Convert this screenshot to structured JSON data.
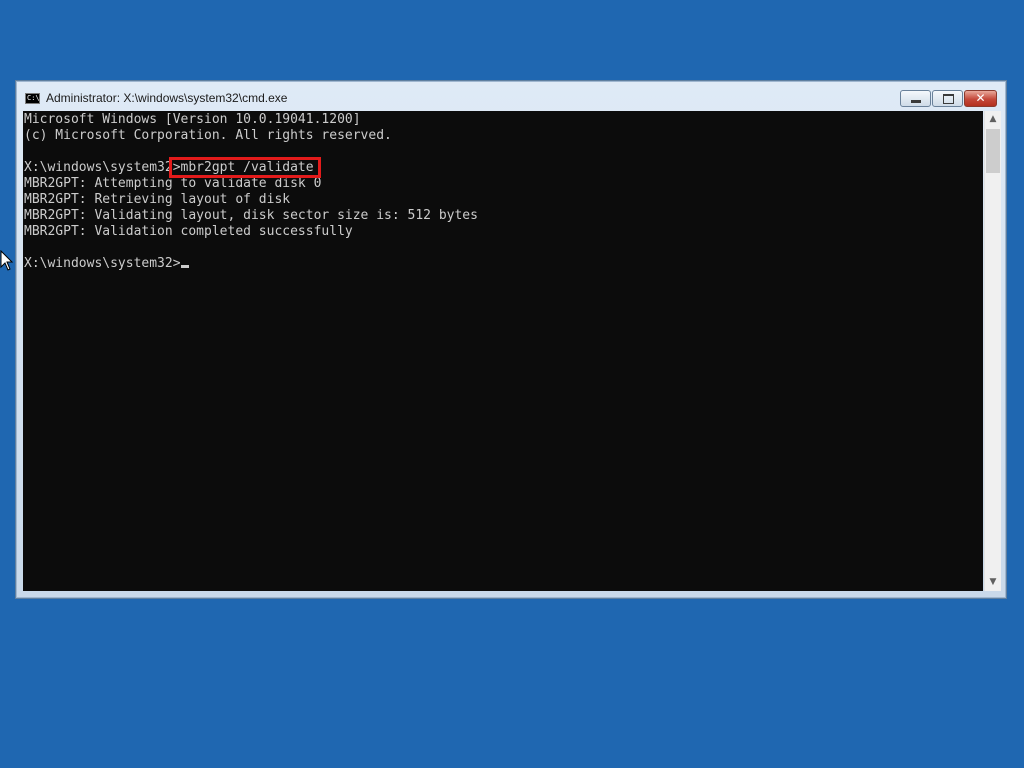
{
  "window": {
    "title": "Administrator: X:\\windows\\system32\\cmd.exe",
    "icon_text": "C:\\",
    "controls": {
      "minimize": "minimize-icon",
      "maximize": "maximize-icon",
      "close": "close-icon",
      "close_glyph": "✕"
    }
  },
  "console": {
    "lines": [
      "Microsoft Windows [Version 10.0.19041.1200]",
      "(c) Microsoft Corporation. All rights reserved.",
      "",
      "X:\\windows\\system32>mbr2gpt /validate",
      "MBR2GPT: Attempting to validate disk 0",
      "MBR2GPT: Retrieving layout of disk",
      "MBR2GPT: Validating layout, disk sector size is: 512 bytes",
      "MBR2GPT: Validation completed successfully",
      "",
      "X:\\windows\\system32>"
    ],
    "highlighted_command": "mbr2gpt /validate",
    "highlight_color": "#e31b1b",
    "text_color": "#cccccc",
    "background_color": "#0c0c0c"
  },
  "scrollbar": {
    "up_arrow": "▲",
    "down_arrow": "▼"
  },
  "desktop": {
    "background_color": "#1f67b1"
  }
}
